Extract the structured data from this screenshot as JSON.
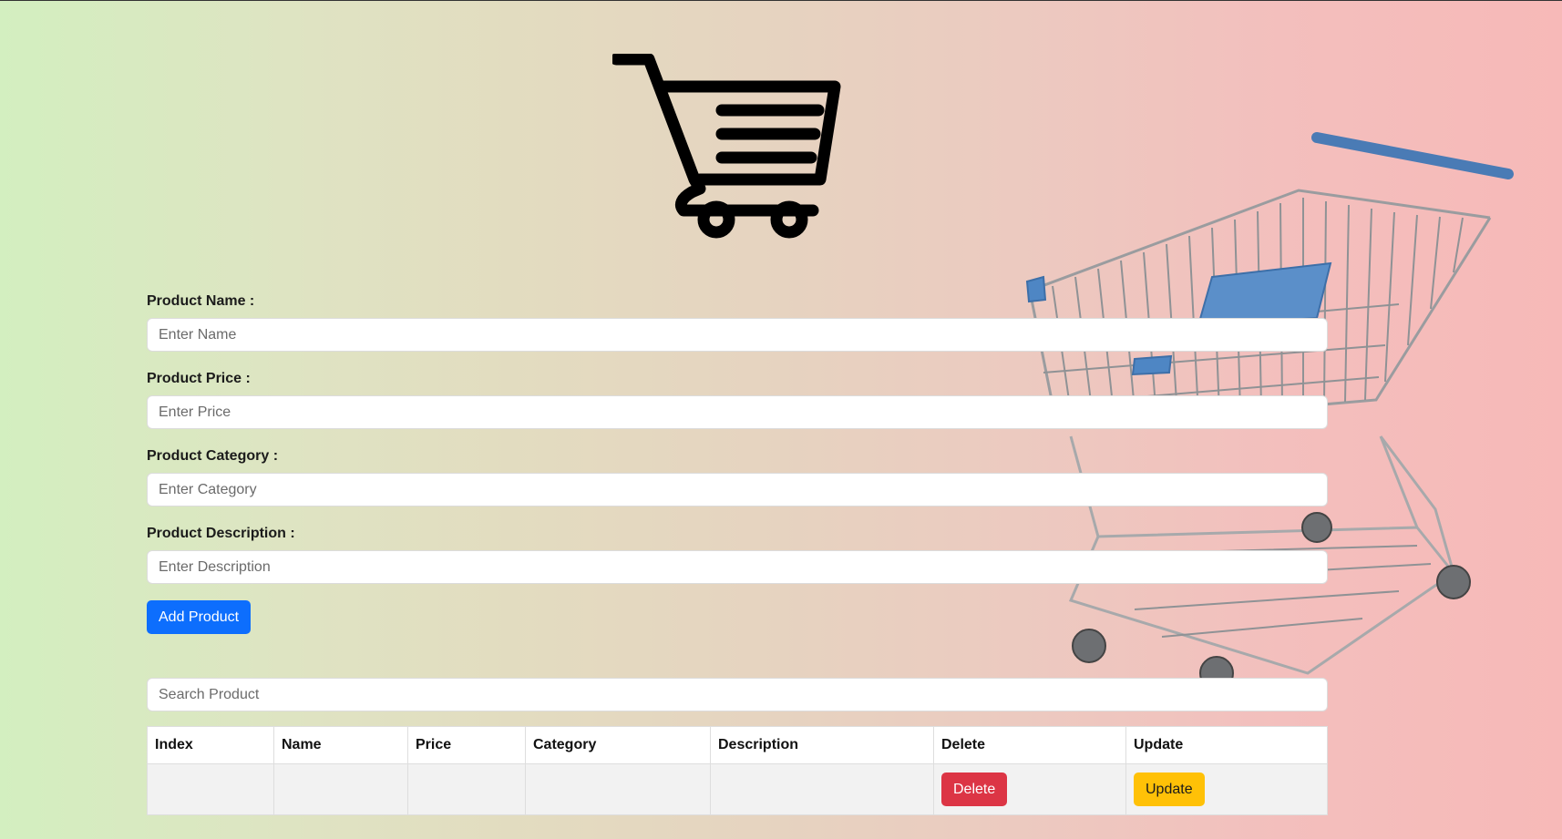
{
  "logo": {
    "icon": "shopping-cart-icon"
  },
  "background": {
    "image": "shopping-cart-photo"
  },
  "form": {
    "fields": [
      {
        "label": "Product Name :",
        "placeholder": "Enter Name",
        "value": ""
      },
      {
        "label": "Product Price :",
        "placeholder": "Enter Price",
        "value": ""
      },
      {
        "label": "Product Category :",
        "placeholder": "Enter Category",
        "value": ""
      },
      {
        "label": "Product Description :",
        "placeholder": "Enter Description",
        "value": ""
      }
    ],
    "add_button": "Add Product"
  },
  "search": {
    "placeholder": "Search Product",
    "value": ""
  },
  "table": {
    "headers": [
      "Index",
      "Name",
      "Price",
      "Category",
      "Description",
      "Delete",
      "Update"
    ],
    "rows": [
      {
        "index": "",
        "name": "",
        "price": "",
        "category": "",
        "description": "",
        "delete_label": "Delete",
        "update_label": "Update"
      }
    ]
  },
  "colors": {
    "primary": "#0d6efd",
    "danger": "#dc3545",
    "warning": "#ffc107",
    "gradient_left": "#d3efc0",
    "gradient_right": "#f7b9b8"
  }
}
